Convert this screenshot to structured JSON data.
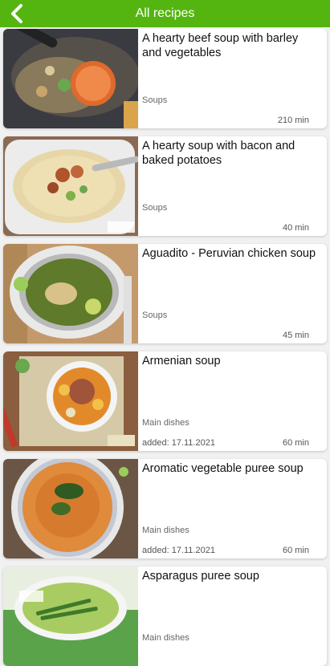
{
  "header": {
    "title": "All recipes",
    "back_icon": "chevron-left-icon"
  },
  "recipes": [
    {
      "name": "A hearty beef soup with barley and vegetables",
      "category": "Soups",
      "added": "",
      "time": "210 min"
    },
    {
      "name": "A hearty soup with bacon and baked potatoes",
      "category": "Soups",
      "added": "",
      "time": "40 min"
    },
    {
      "name": "Aguadito - Peruvian chicken soup",
      "category": "Soups",
      "added": "",
      "time": "45 min"
    },
    {
      "name": "Armenian soup",
      "category": "Main dishes",
      "added": "added: 17.11.2021",
      "time": "60 min"
    },
    {
      "name": "Aromatic vegetable puree soup",
      "category": "Main dishes",
      "added": "added: 17.11.2021",
      "time": "60 min"
    },
    {
      "name": "Asparagus puree soup",
      "category": "Main dishes",
      "added": "",
      "time": ""
    }
  ],
  "colors": {
    "header_bg": "#54b510",
    "card_bg": "#ffffff",
    "page_bg": "#f1f1f1"
  }
}
